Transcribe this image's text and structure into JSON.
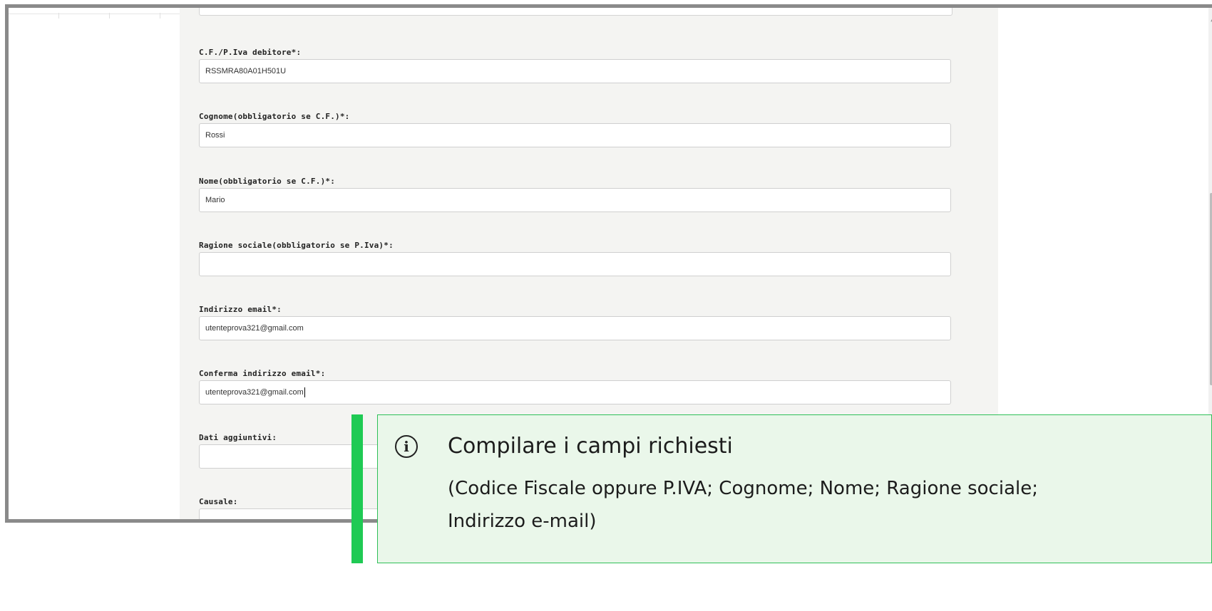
{
  "form": {
    "fields": [
      {
        "label": "C.F./P.Iva debitore*:",
        "value": "RSSMRA80A01H501U"
      },
      {
        "label": "Cognome(obbligatorio se C.F.)*:",
        "value": "Rossi"
      },
      {
        "label": "Nome(obbligatorio se C.F.)*:",
        "value": "Mario"
      },
      {
        "label": "Ragione sociale(obbligatorio se P.Iva)*:",
        "value": ""
      },
      {
        "label": "Indirizzo email*:",
        "value": "utenteprova321@gmail.com"
      },
      {
        "label": "Conferma indirizzo email*:",
        "value": "utenteprova321@gmail.com"
      },
      {
        "label": "Dati aggiuntivi:",
        "value": ""
      },
      {
        "label": "Causale:",
        "value": ""
      }
    ]
  },
  "callout": {
    "icon": "info-icon",
    "title": "Compilare i campi richiesti",
    "text": "(Codice Fiscale oppure P.IVA; Cognome; Nome; Ragione sociale; Indirizzo e-mail)",
    "accent_color": "#1fca54",
    "background_color": "#eaf7ea"
  }
}
